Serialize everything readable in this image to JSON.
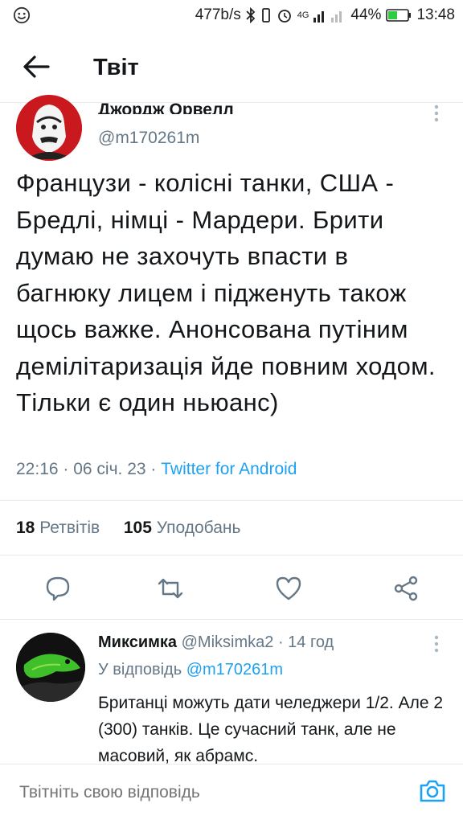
{
  "status_bar": {
    "speed": "477b/s",
    "network": "4G",
    "battery": "44%",
    "time": "13:48"
  },
  "header": {
    "title": "Твіт"
  },
  "tweet": {
    "author_name": "Джордж Орвелл",
    "handle": "@m170261m",
    "text": "Французи - колісні танки, США - Бредлі, німці - Мардери. Брити думаю не захочуть впасти  в багнюку лицем і підженуть також щось важке. Анонсована путіним демілітаризація йде повним ходом. Тільки є один ньюанс)",
    "time": "22:16",
    "date": "06 січ. 23",
    "source": "Twitter for Android",
    "retweets_count": "18",
    "retweets_label": "Ретвітів",
    "likes_count": "105",
    "likes_label": "Уподобань"
  },
  "reply": {
    "author_name": "Миксимка",
    "handle": "@Miksimka2",
    "age": "14 год",
    "replying_to_label": "У відповідь",
    "replying_to_handle": "@m170261m",
    "text": "Британці можуть дати челеджери 1/2. Але 2 (300) танків. Це сучасний танк, але не масовий, як абрамс."
  },
  "composer": {
    "placeholder": "Твітніть свою відповідь"
  },
  "colors": {
    "accent": "#1da1f2",
    "muted": "#657786",
    "text": "#14171a"
  },
  "icons": [
    "smiley-icon",
    "bluetooth-icon",
    "vibrate-icon",
    "alarm-icon",
    "signal-icon",
    "battery-icon",
    "back-arrow-icon",
    "more-vertical-icon",
    "reply-icon",
    "retweet-icon",
    "like-icon",
    "share-icon",
    "camera-icon"
  ]
}
